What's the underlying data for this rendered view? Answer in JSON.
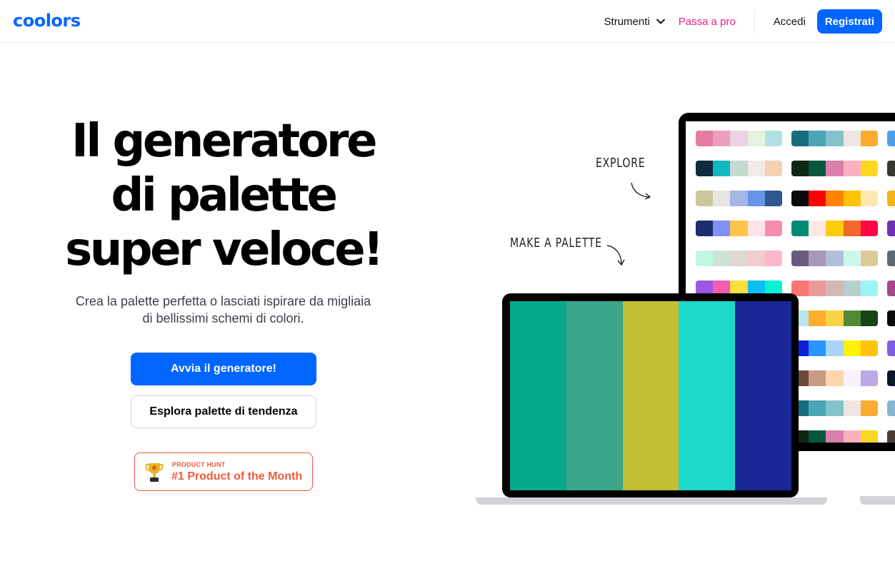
{
  "header": {
    "logo_text": "coolors",
    "nav": {
      "tools_label": "Strumenti",
      "pro_label": "Passa a pro",
      "login_label": "Accedi",
      "register_label": "Registrati"
    }
  },
  "hero": {
    "title_lines": [
      "Il generatore",
      "di palette",
      "super veloce!"
    ],
    "subtitle": "Crea la palette perfetta o lasciati ispirare da migliaia di bellissimi schemi di colori.",
    "primary_button": "Avvia il generatore!",
    "secondary_button": "Esplora palette di tendenza",
    "badge": {
      "small_text": "PRODUCT HUNT",
      "big_text": "#1 Product of the Month"
    }
  },
  "illustration": {
    "annotation_explore": "EXPLORE",
    "annotation_make": "MAKE A PALETTE",
    "laptop_palette": [
      "#06a98a",
      "#3aa68a",
      "#c2bf36",
      "#1ed8cc",
      "#182696"
    ],
    "monitor_palettes_col1": [
      [
        "#e47ca1",
        "#ee9fbd",
        "#eed1e4",
        "#e6f2dd",
        "#b3e0e4"
      ],
      [
        "#102a3e",
        "#10b9c0",
        "#c4d9d0",
        "#f2e9e8",
        "#f1d1b0"
      ],
      [
        "#ccc59b",
        "#e6e6e2",
        "#a4b6e4",
        "#6694e6",
        "#2f568e"
      ],
      [
        "#1e2e6c",
        "#8090f6",
        "#fdc54a",
        "#fce5e8",
        "#f88cac"
      ],
      [
        "#c0f6e2",
        "#cfe2d8",
        "#e0d6d2",
        "#f0ccd0",
        "#fcb8c8"
      ],
      [
        "#9a56e2",
        "#f45cb2",
        "#fbdf3e",
        "#0bbff2",
        "#02f5d5"
      ]
    ],
    "monitor_palettes_col2": [
      [
        "#186d7c",
        "#4aa6b6",
        "#84c2cc",
        "#efe6e0",
        "#fbab30"
      ],
      [
        "#0f2614",
        "#07583a",
        "#db7eab",
        "#f9b1c0",
        "#fcd820"
      ],
      [
        "#0b0a0b",
        "#ff0000",
        "#ff8200",
        "#ffc205",
        "#fce9b2"
      ],
      [
        "#028b73",
        "#fde9e2",
        "#fdcc0a",
        "#f2672a",
        "#ff0747"
      ],
      [
        "#675c80",
        "#a797bd",
        "#b1c0d8",
        "#cef6ef",
        "#dccb9a"
      ],
      [
        "#fc7575",
        "#e99999",
        "#d5b6b6",
        "#b6d0d0",
        "#9bf5f5"
      ],
      [
        "#b8e4ee",
        "#fcad2a",
        "#fcd347",
        "#538834",
        "#154616"
      ],
      [
        "#0d1fd8",
        "#2796ff",
        "#a9d4fc",
        "#fff10a",
        "#ffc40a"
      ],
      [
        "#6a4a3b",
        "#c69d84",
        "#fed5ad",
        "#f9f2fb",
        "#bda8e6"
      ],
      [
        "#186d7c",
        "#4aa6b6",
        "#84c2cc",
        "#efe6e0",
        "#fbab30"
      ],
      [
        "#0f2614",
        "#07583a",
        "#db7eab",
        "#f9b1c0",
        "#fcd820"
      ]
    ],
    "monitor_palettes_col3": [
      "#4ca0e6",
      "#3a3630",
      "#f2b21a",
      "#6a32b0",
      "#5e6a72",
      "#a4458e",
      "#0b0b0b",
      "#7f5ee4",
      "#08182a",
      "#89b5d2",
      "#4a3c34"
    ]
  }
}
